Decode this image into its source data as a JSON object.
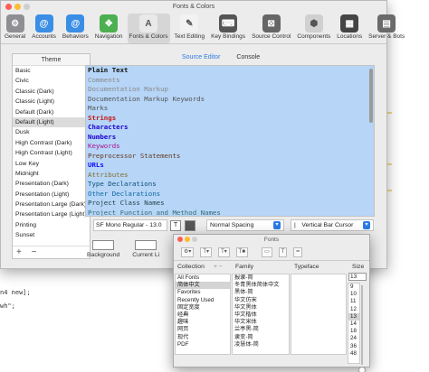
{
  "background": {
    "code_lines": [
      "",
      "n4 new];",
      "wh\";",
      "",
      "",
      "",
      ""
    ]
  },
  "window": {
    "title": "Fonts & Colors"
  },
  "toolbar": {
    "items": [
      {
        "label": "General",
        "glyph": "⚙",
        "color": "#8e8e93",
        "active": false
      },
      {
        "label": "Accounts",
        "glyph": "@",
        "color": "#3a8ee6",
        "active": false
      },
      {
        "label": "Behaviors",
        "glyph": "@",
        "color": "#3a8ee6",
        "active": false
      },
      {
        "label": "Navigation",
        "glyph": "✥",
        "color": "#4caf50",
        "active": false
      },
      {
        "label": "Fonts & Colors",
        "glyph": "A",
        "color": "#e9e9e9",
        "active": true
      },
      {
        "label": "Text Editing",
        "glyph": "✎",
        "color": "#f2f2f2",
        "active": false
      },
      {
        "label": "Key Bindings",
        "glyph": "⌨",
        "color": "#555555",
        "active": false
      },
      {
        "label": "Source Control",
        "glyph": "⊠",
        "color": "#666666",
        "active": false
      },
      {
        "label": "Components",
        "glyph": "⬢",
        "color": "#d0d0d0",
        "active": false
      },
      {
        "label": "Locations",
        "glyph": "▦",
        "color": "#444444",
        "active": false
      },
      {
        "label": "Server & Bots",
        "glyph": "▤",
        "color": "#6a6a6a",
        "active": false
      }
    ]
  },
  "themes": {
    "header": "Theme",
    "items": [
      "Basic",
      "Civic",
      "Classic (Dark)",
      "Classic (Light)",
      "Default (Dark)",
      "Default (Light)",
      "Dusk",
      "High Contrast (Dark)",
      "High Contrast (Light)",
      "Low Key",
      "Midnight",
      "Presentation (Dark)",
      "Presentation (Light)",
      "Presentation Large (Dark)",
      "Presentation Large (Light)",
      "Printing",
      "Sunset"
    ],
    "selected_index": 5,
    "add_label": "+",
    "remove_label": "−"
  },
  "tabs": [
    {
      "label": "Source Editor",
      "active": true
    },
    {
      "label": "Console",
      "active": false
    }
  ],
  "syntax_items": [
    {
      "label": "Plain Text",
      "color": "#111111",
      "bold": true
    },
    {
      "label": "Comments",
      "color": "#8a8a8a",
      "bold": false
    },
    {
      "label": "Documentation Markup",
      "color": "#8a8a8a",
      "bold": false
    },
    {
      "label": "Documentation Markup Keywords",
      "color": "#555555",
      "bold": false
    },
    {
      "label": "Marks",
      "color": "#555555",
      "bold": false
    },
    {
      "label": "Strings",
      "color": "#c41a16",
      "bold": true
    },
    {
      "label": "Characters",
      "color": "#1c00cf",
      "bold": true
    },
    {
      "label": "Numbers",
      "color": "#1c00cf",
      "bold": true
    },
    {
      "label": "Keywords",
      "color": "#aa0d91",
      "bold": false
    },
    {
      "label": "Preprocessor Statements",
      "color": "#643820",
      "bold": false
    },
    {
      "label": "URLs",
      "color": "#0e0eff",
      "bold": true
    },
    {
      "label": "Attributes",
      "color": "#836c28",
      "bold": false
    },
    {
      "label": "Type Declarations",
      "color": "#0b4f79",
      "bold": false
    },
    {
      "label": "Other Declarations",
      "color": "#0f68a0",
      "bold": false
    },
    {
      "label": "Project Class Names",
      "color": "#1c464a",
      "bold": false
    },
    {
      "label": "Project Function and Method Names",
      "color": "#326d74",
      "bold": false
    },
    {
      "label": "Project Constants",
      "color": "#326d74",
      "bold": false
    },
    {
      "label": "Project Type Names",
      "color": "#1c464a",
      "bold": false
    },
    {
      "label": "Project Instance Variables and Globals",
      "color": "#326d74",
      "bold": false
    }
  ],
  "font_row": {
    "font_field": "SF Mono Regular - 13.0",
    "t_button": "T",
    "spacing": "Normal Spacing",
    "cursor": "Vertical Bar Cursor"
  },
  "swatches": [
    {
      "label": "Background"
    },
    {
      "label": "Current Li"
    }
  ],
  "fonts_panel": {
    "title": "Fonts",
    "collection_head": "Collection",
    "family_head": "Family",
    "typeface_head": "Typeface",
    "size_head": "Size",
    "size_value": "13",
    "collections": [
      "All Fonts",
      "简体中文",
      "Favorites",
      "Recently Used",
      "固定宽度",
      "经典",
      "趣味",
      "网页",
      "现代",
      "PDF"
    ],
    "collection_selected": 1,
    "families": [
      "报隶-简",
      "冬青黑体简体中文",
      "黑体-简",
      "华文仿宋",
      "华文黑体",
      "华文楷体",
      "华文宋体",
      "兰亭黑-简",
      "隶变-简",
      "凌慧体-简"
    ],
    "sizes": [
      "9",
      "10",
      "11",
      "12",
      "13",
      "14",
      "18",
      "24",
      "36",
      "48"
    ],
    "size_selected": 4
  }
}
